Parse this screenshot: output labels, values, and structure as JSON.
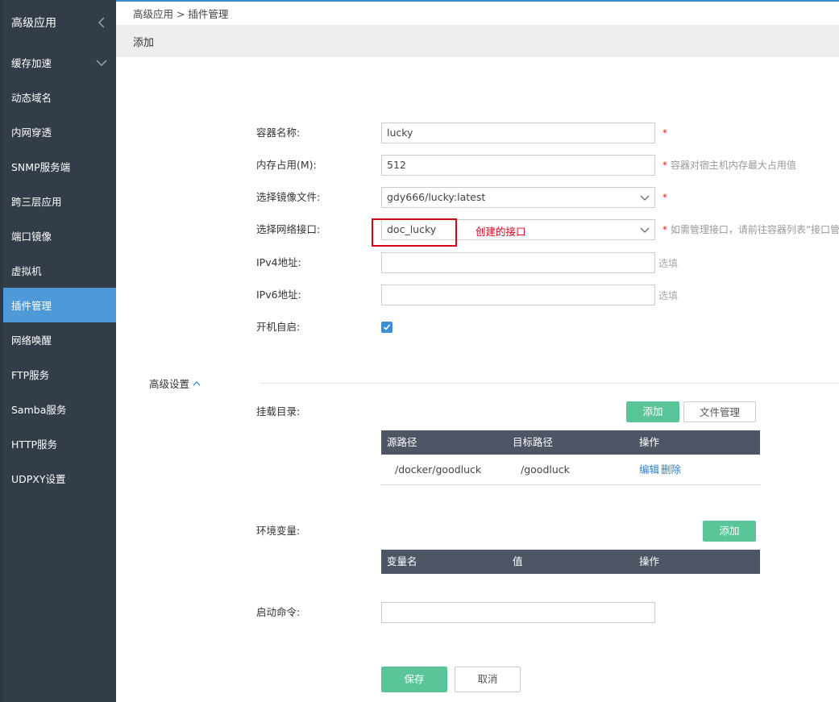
{
  "sidebar": {
    "header": "高级应用",
    "items": [
      {
        "label": "缓存加速",
        "expandable": true
      },
      {
        "label": "动态域名"
      },
      {
        "label": "内网穿透"
      },
      {
        "label": "SNMP服务端"
      },
      {
        "label": "跨三层应用"
      },
      {
        "label": "端口镜像"
      },
      {
        "label": "虚拟机"
      },
      {
        "label": "插件管理",
        "active": true
      },
      {
        "label": "网络唤醒"
      },
      {
        "label": "FTP服务"
      },
      {
        "label": "Samba服务"
      },
      {
        "label": "HTTP服务"
      },
      {
        "label": "UDPXY设置"
      }
    ]
  },
  "breadcrumb": "高级应用 > 插件管理",
  "page_title": "添加",
  "form": {
    "container_name": {
      "label": "容器名称:",
      "value": "lucky",
      "required": "*"
    },
    "memory": {
      "label": "内存占用(M):",
      "value": "512",
      "required": "*",
      "hint": "容器对宿主机内存最大占用值"
    },
    "image": {
      "label": "选择镜像文件:",
      "value": "gdy666/lucky:latest",
      "required": "*"
    },
    "network": {
      "label": "选择网络接口:",
      "value": "doc_lucky",
      "required": "*",
      "hint": "如需管理接口，请前往容器列表“接口管"
    },
    "ipv4": {
      "label": "IPv4地址:",
      "value": "",
      "optional": "选填"
    },
    "ipv6": {
      "label": "IPv6地址:",
      "value": "",
      "optional": "选填"
    },
    "autostart": {
      "label": "开机自启:",
      "checked": true
    }
  },
  "annotation": "创建的接口",
  "advanced": {
    "title": "高级设置",
    "mount": {
      "label": "挂载目录:",
      "add_button": "添加",
      "file_button": "文件管理",
      "columns": [
        "源路径",
        "目标路径",
        "操作"
      ],
      "rows": [
        {
          "source": "/docker/goodluck",
          "target": "/goodluck",
          "edit": "编辑",
          "delete": "删除"
        }
      ]
    },
    "env": {
      "label": "环境变量:",
      "add_button": "添加",
      "columns": [
        "变量名",
        "值",
        "操作"
      ]
    },
    "command": {
      "label": "启动命令:",
      "value": ""
    }
  },
  "actions": {
    "save": "保存",
    "cancel": "取消"
  },
  "colors": {
    "sidebar_bg": "#333c49",
    "active": "#4e9ad9",
    "green": "#5bc59a",
    "table_head": "#4e5565",
    "highlight": "#d9001b"
  }
}
